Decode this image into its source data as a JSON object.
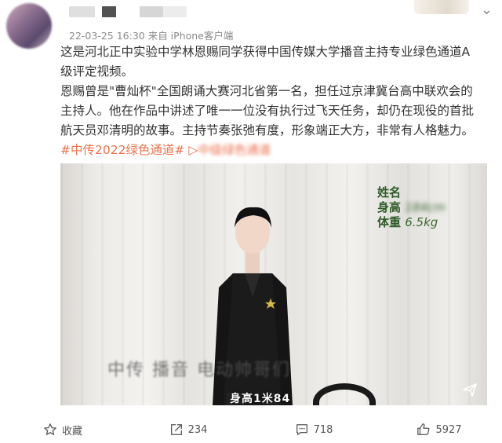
{
  "header": {
    "meta": "22-03-25 16:30 来自 iPhone客户端",
    "menu_icon": "chevron-down-icon"
  },
  "post": {
    "para1": "这是河北正中实验中学林恩赐同学获得中国传媒大学播音主持专业绿色通道A级评定视频。",
    "para2_text": "恩赐曾是\"曹灿杯\"全国朗诵大赛河北省第一名，担任过京津冀台高中联欢会的主持人。他在作品中讲述了唯一一位没有执行过飞天任务，却仍在现役的首批航天员邓清明的故事。主持节奏张弛有度，形象端正大方，非常有人格魅力。",
    "hashtag": "#中传2022绿色通道#",
    "link_text": "中级绿色通道"
  },
  "video": {
    "stats": [
      {
        "label": "姓名",
        "value": ""
      },
      {
        "label": "身高",
        "value": "184cm"
      },
      {
        "label": "体重",
        "value": "6.5kg"
      }
    ],
    "subtitle": "中传 播音 电动帅哥们",
    "caption": "身高1米84",
    "play_icon": "send-icon"
  },
  "actions": [
    {
      "name": "favorite",
      "label": "收藏",
      "icon": "star-icon"
    },
    {
      "name": "repost",
      "label": "234",
      "icon": "share-icon"
    },
    {
      "name": "comment",
      "label": "718",
      "icon": "comment-icon"
    },
    {
      "name": "like",
      "label": "5927",
      "icon": "thumbs-up-icon"
    }
  ],
  "colors": {
    "hashtag": "#eb7350",
    "meta": "#8a8a8a",
    "text": "#333333",
    "stats_text": "#2f5a28"
  }
}
